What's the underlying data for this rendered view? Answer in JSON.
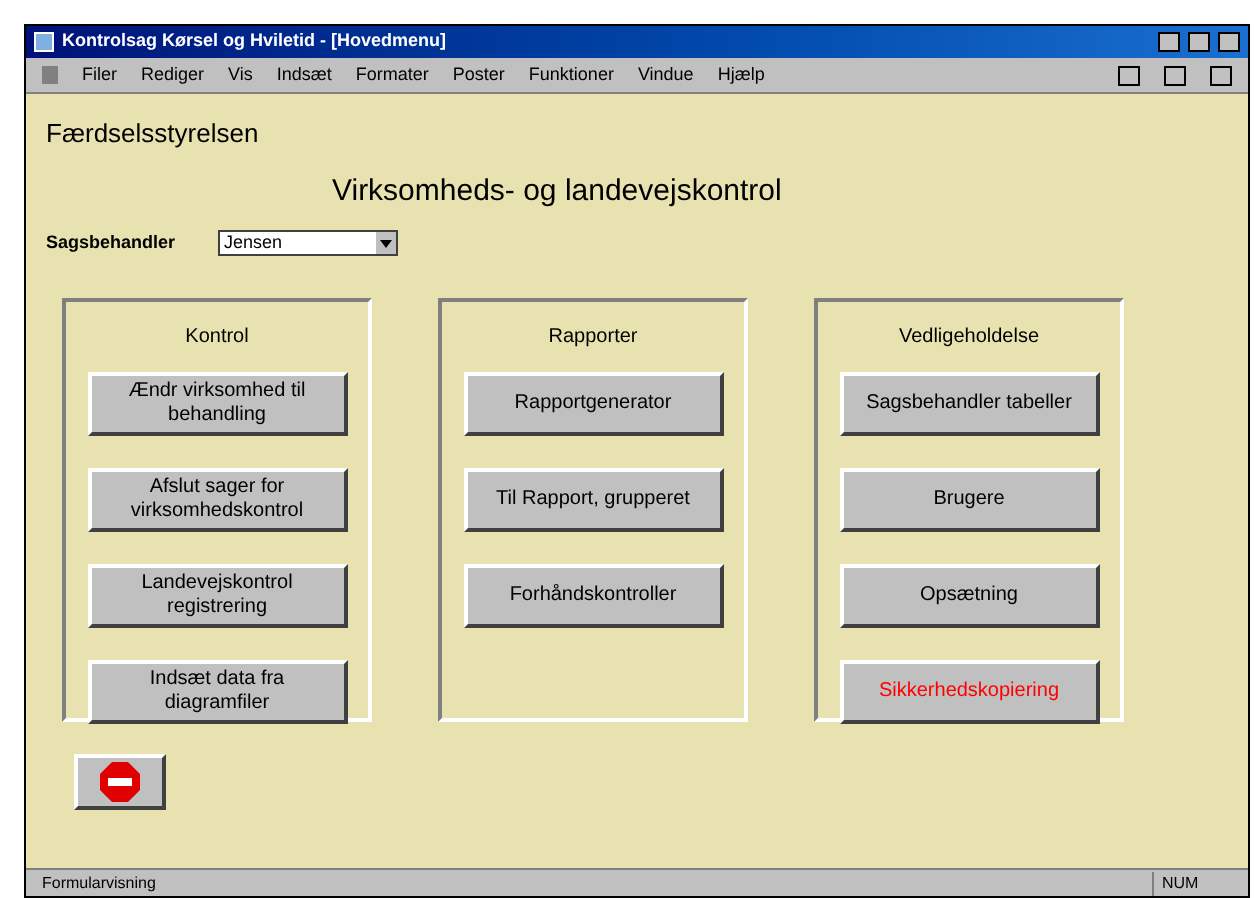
{
  "window": {
    "title": "Kontrolsag Kørsel og Hviletid - [Hovedmenu]"
  },
  "menu_bar": [
    "Filer",
    "Rediger",
    "Vis",
    "Indsæt",
    "Formater",
    "Poster",
    "Funktioner",
    "Vindue",
    "Hjælp"
  ],
  "header": {
    "organization": "Færdselsstyrelsen",
    "title": "Virksomheds- og landevejskontrol"
  },
  "case_officer": {
    "label": "Sagsbehandler",
    "value": "Jensen"
  },
  "groups": [
    {
      "title": "Kontrol",
      "buttons": [
        {
          "label": "Ændr virksomhed til behandling",
          "color": "#000000"
        },
        {
          "label": "Afslut sager for virksomhedskontrol",
          "color": "#000000"
        },
        {
          "label": "Landevejskontrol registrering",
          "color": "#000000"
        },
        {
          "label": "Indsæt data fra diagramfiler",
          "color": "#000000"
        }
      ]
    },
    {
      "title": "Rapporter",
      "buttons": [
        {
          "label": "Rapportgenerator",
          "color": "#000000"
        },
        {
          "label": "Til Rapport, grupperet",
          "color": "#000000"
        },
        {
          "label": "Forhåndskontroller",
          "color": "#000000"
        }
      ]
    },
    {
      "title": "Vedligeholdelse",
      "buttons": [
        {
          "label": "Sagsbehandler tabeller",
          "color": "#000000"
        },
        {
          "label": "Brugere",
          "color": "#000000"
        },
        {
          "label": "Opsætning",
          "color": "#000000"
        },
        {
          "label": "Sikkerhedskopiering",
          "color": "#ff0000"
        }
      ]
    }
  ],
  "status_bar": {
    "text": "Formularvisning",
    "indicator": "NUM"
  }
}
